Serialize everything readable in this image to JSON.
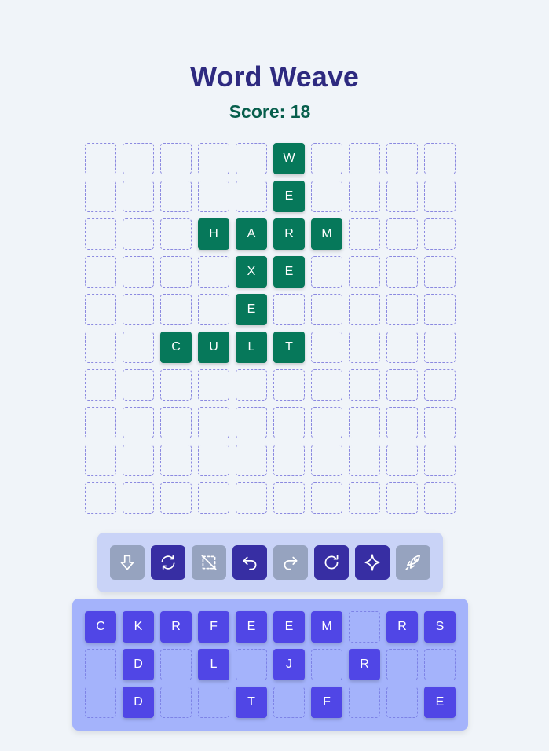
{
  "game": {
    "title": "Word Weave",
    "score_label": "Score: 18"
  },
  "board": {
    "rows": [
      [
        "",
        "",
        "",
        "",
        "",
        "W",
        "",
        "",
        "",
        ""
      ],
      [
        "",
        "",
        "",
        "",
        "",
        "E",
        "",
        "",
        "",
        ""
      ],
      [
        "",
        "",
        "",
        "H",
        "A",
        "R",
        "M",
        "",
        "",
        ""
      ],
      [
        "",
        "",
        "",
        "",
        "X",
        "E",
        "",
        "",
        "",
        ""
      ],
      [
        "",
        "",
        "",
        "",
        "E",
        "",
        "",
        "",
        "",
        ""
      ],
      [
        "",
        "",
        "C",
        "U",
        "L",
        "T",
        "",
        "",
        "",
        ""
      ],
      [
        "",
        "",
        "",
        "",
        "",
        "",
        "",
        "",
        "",
        ""
      ],
      [
        "",
        "",
        "",
        "",
        "",
        "",
        "",
        "",
        "",
        ""
      ],
      [
        "",
        "",
        "",
        "",
        "",
        "",
        "",
        "",
        "",
        ""
      ],
      [
        "",
        "",
        "",
        "",
        "",
        "",
        "",
        "",
        "",
        ""
      ]
    ]
  },
  "toolbar": {
    "tools": [
      {
        "icon": "drop-down-icon",
        "state": "disabled"
      },
      {
        "icon": "shuffle-icon",
        "state": "active"
      },
      {
        "icon": "clear-selection-icon",
        "state": "disabled"
      },
      {
        "icon": "undo-icon",
        "state": "active"
      },
      {
        "icon": "redo-icon",
        "state": "disabled"
      },
      {
        "icon": "reset-icon",
        "state": "active"
      },
      {
        "icon": "hint-sparkle-icon",
        "state": "active"
      },
      {
        "icon": "rocket-icon",
        "state": "disabled"
      }
    ]
  },
  "rack": {
    "rows": [
      [
        "C",
        "K",
        "R",
        "F",
        "E",
        "E",
        "M",
        "",
        "R",
        "S"
      ],
      [
        "",
        "D",
        "",
        "L",
        "",
        "J",
        "",
        "R",
        "",
        ""
      ],
      [
        "",
        "D",
        "",
        "",
        "T",
        "",
        "F",
        "",
        "",
        "E"
      ]
    ]
  },
  "colors": {
    "background": "#f0f4f9",
    "title": "#2e2a80",
    "score": "#075e4c",
    "board_tile": "#06785a",
    "rack_tile": "#5046e6",
    "tool_active": "#372ea3",
    "tool_disabled": "#96a3bf",
    "toolbar_panel": "#c9d3f7",
    "rack_panel": "#a4b3fb"
  }
}
